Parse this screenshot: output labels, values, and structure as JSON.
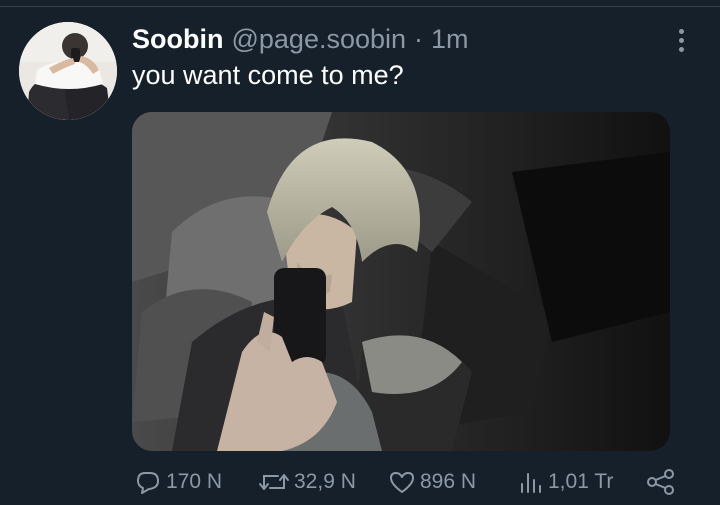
{
  "tweet": {
    "display_name": "Soobin",
    "handle": "@page.soobin",
    "separator": "·",
    "time": "1m",
    "text": "you want come to me?"
  },
  "actions": {
    "replies": "170 N",
    "retweets": "32,9 N",
    "likes": "896 N",
    "views": "1,01 Tr"
  },
  "icons": {
    "reply": "speech-bubble-icon",
    "retweet": "retweet-icon",
    "like": "heart-icon",
    "views": "bar-chart-icon",
    "share": "share-icon",
    "more": "vertical-dots-icon"
  },
  "colors": {
    "background": "#15202b",
    "text": "#ffffff",
    "muted": "#8b98a5",
    "divider": "#38444d"
  }
}
